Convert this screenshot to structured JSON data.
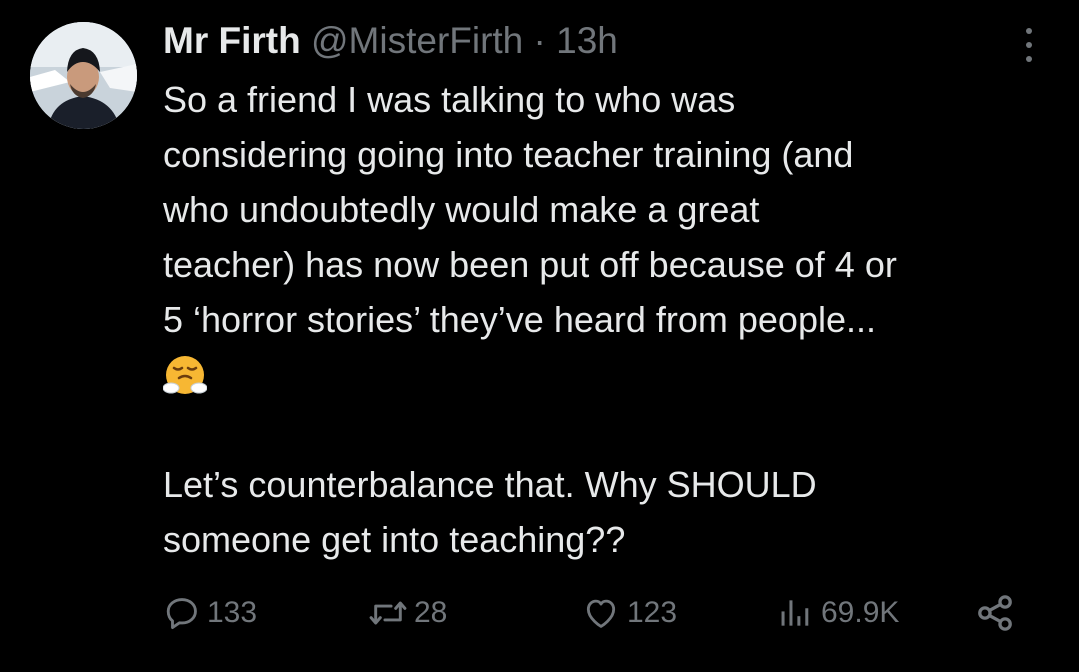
{
  "tweet": {
    "author": {
      "name": "Mr Firth",
      "handle": "@MisterFirth",
      "separator": "·",
      "time": "13h"
    },
    "lines": [
      "So a friend I was talking to who was",
      "considering going into teacher training (and",
      "who undoubtedly would make a great",
      "teacher) has now been put off because of 4 or",
      "5 ‘horror stories’ they’ve heard from people..."
    ],
    "emoji_icon": "huffing-face-emoji",
    "lines2": [
      "Let’s counterbalance that. Why SHOULD",
      "someone get into teaching??"
    ]
  },
  "actions": {
    "replies": "133",
    "reposts": "28",
    "likes": "123",
    "views": "69.9K"
  },
  "icons": {
    "reply": "reply-icon",
    "repost": "repost-icon",
    "like": "heart-icon",
    "views": "views-icon",
    "share": "share-icon",
    "more": "more-icon"
  },
  "colors": {
    "background": "#000000",
    "text": "#e7e9ea",
    "muted": "#71767b"
  }
}
